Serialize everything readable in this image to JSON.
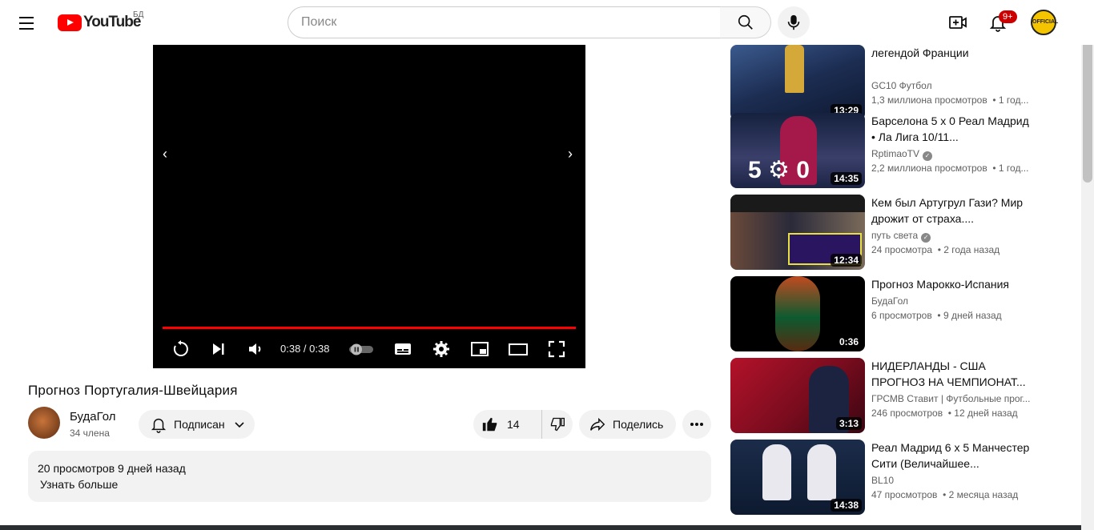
{
  "header": {
    "logo_text": "YouTube",
    "country": "БД",
    "search_placeholder": "Поиск",
    "notifications_badge": "9+",
    "avatar_text": "OFFICIAL"
  },
  "player": {
    "time": "0:38 / 0:38",
    "progress": 1.0
  },
  "video": {
    "title": "Прогноз Португалия-Швейцария",
    "channel": "БудаГол",
    "subscribers": "34 члена",
    "subscribe_label": "Подписан",
    "likes": "14",
    "share_label": "Поделись",
    "desc_stats": "20 просмотров 9 дней назад",
    "desc_more": "Узнать больше"
  },
  "sidebar": [
    {
      "title": "легендой Франции",
      "channel": "GC10 Футбол",
      "verified": false,
      "views": "1,3 миллиона просмотров",
      "age": "1 год...",
      "duration": "13:29"
    },
    {
      "title": "Барселона 5 х 0 Реал Мадрид • Ла Лига 10/11...",
      "channel": "RptimaoTV",
      "verified": true,
      "views": "2,2 миллиона просмотров",
      "age": "1 год...",
      "duration": "14:35"
    },
    {
      "title": "Кем был Артугрул Гази? Мир дрожит от страха....",
      "channel": "путь света",
      "verified": true,
      "views": "24 просмотра",
      "age": "2 года назад",
      "duration": "12:34"
    },
    {
      "title": "Прогноз Марокко-Испания",
      "channel": "БудаГол",
      "verified": false,
      "views": "6 просмотров",
      "age": "9 дней назад",
      "duration": "0:36"
    },
    {
      "title": "НИДЕРЛАНДЫ - США ПРОГНОЗ НА ЧЕМПИОНАТ...",
      "channel": "ГРСМВ Ставит | Футбольные прог...",
      "verified": false,
      "views": "246 просмотров",
      "age": "12 дней назад",
      "duration": "3:13"
    },
    {
      "title": "Реал Мадрид 6 х 5 Манчестер Сити (Величайшее...",
      "channel": "BL10",
      "verified": false,
      "views": "47 просмотров",
      "age": "2 месяца назад",
      "duration": "14:38"
    }
  ]
}
